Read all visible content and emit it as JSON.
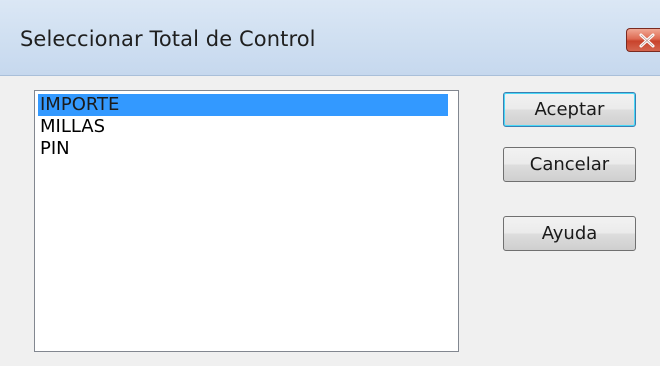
{
  "window": {
    "title": "Seleccionar Total de Control",
    "close_icon": "close-icon",
    "close_color": "#d4654e"
  },
  "list": {
    "items": [
      {
        "label": "IMPORTE",
        "selected": true
      },
      {
        "label": "MILLAS",
        "selected": false
      },
      {
        "label": "PIN",
        "selected": false
      }
    ],
    "selection_color": "#3399ff"
  },
  "buttons": {
    "ok_label": "Aceptar",
    "cancel_label": "Cancelar",
    "help_label": "Ayuda"
  }
}
